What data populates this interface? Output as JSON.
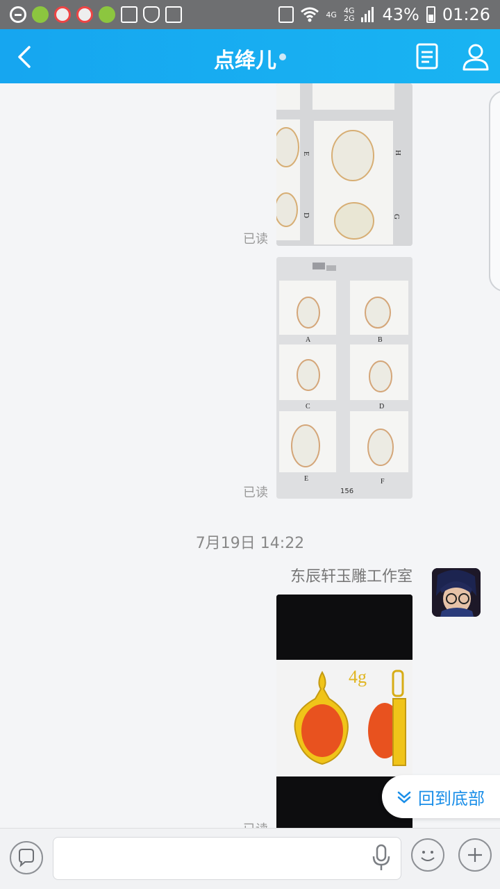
{
  "status_bar": {
    "network_top": "4G",
    "network_2g": "2G",
    "battery": "43%",
    "time": "01:26"
  },
  "header": {
    "title": "点绛儿",
    "back_icon": "chevron-left-icon",
    "doc_icon": "document-icon",
    "profile_icon": "person-icon"
  },
  "messages": [
    {
      "type": "image",
      "read_label": "已读",
      "subject": "jade pendants catalog page (G, H, D, E)"
    },
    {
      "type": "image",
      "read_label": "已读",
      "labels": [
        "A",
        "B",
        "C",
        "D",
        "E",
        "F"
      ],
      "page_no": "156"
    },
    {
      "type": "timestamp",
      "text": "7月19日 14:22"
    },
    {
      "type": "image",
      "sender": "东辰轩玉雕工作室",
      "read_label": "已读",
      "photo_caption": "4g"
    }
  ],
  "jump_button": {
    "label": "回到底部"
  },
  "colors": {
    "header": "#16a6f0",
    "accent_text": "#1a8ee8",
    "status_bar": "#6e6f71"
  }
}
